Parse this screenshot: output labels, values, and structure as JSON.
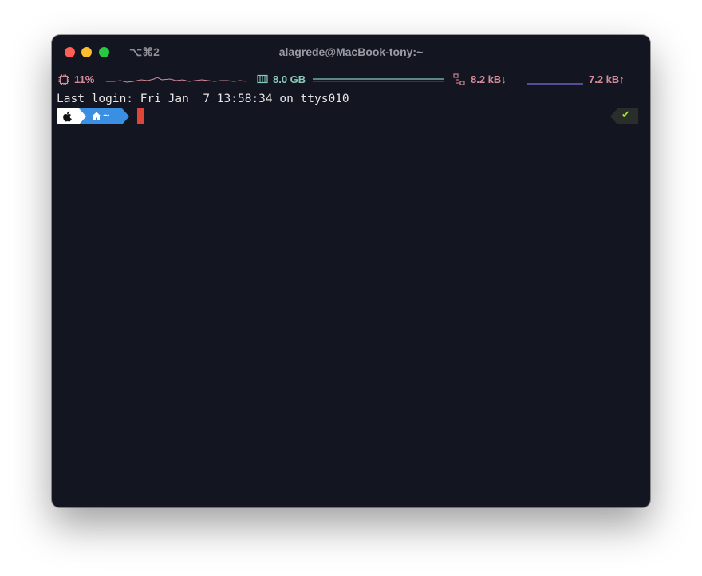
{
  "window": {
    "shortcut": "⌥⌘2",
    "title": "alagrede@MacBook-tony:~"
  },
  "statusbar": {
    "cpu": {
      "icon": "cpu-chip-icon",
      "value": "11%",
      "color": "#d88c9a"
    },
    "memory": {
      "icon": "memory-chip-icon",
      "value": "8.0 GB",
      "color": "#89c9b8"
    },
    "network": {
      "icon": "network-icon",
      "download": "8.2 kB↓",
      "upload": "7.2 kB↑",
      "upload_line_color": "#7b6ee0"
    }
  },
  "terminal": {
    "login_line": "Last login: Fri Jan  7 13:58:34 on ttys010",
    "prompt": {
      "os_icon": "apple-icon",
      "home_icon": "home-icon",
      "dir": "~",
      "home_color": "#3b8fe3",
      "cursor_color": "#e0453a"
    },
    "right_prompt": {
      "status_icon": "check-icon",
      "status": "✔"
    }
  }
}
